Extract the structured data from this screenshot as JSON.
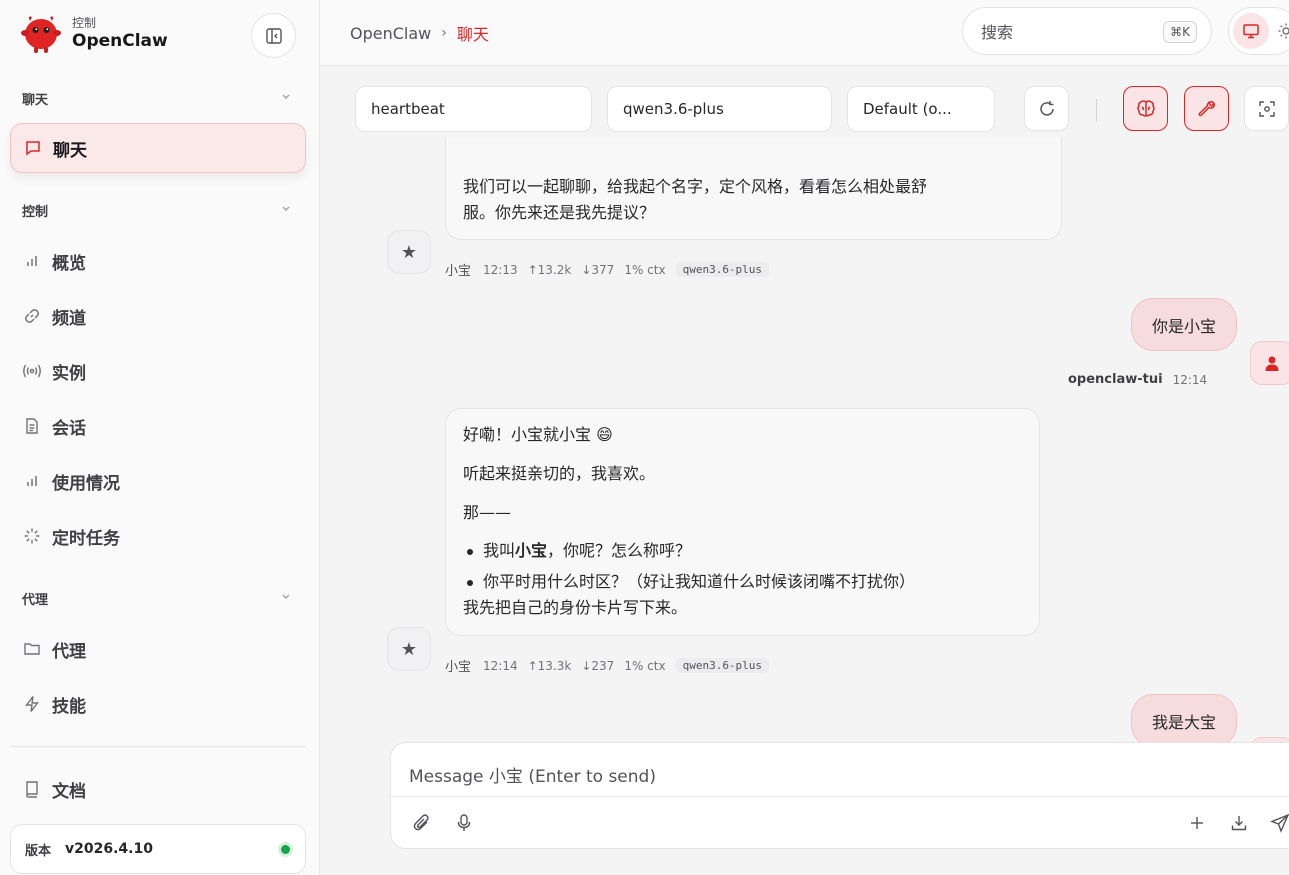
{
  "brand": {
    "subtitle": "控制",
    "name": "OpenClaw"
  },
  "sidebar": {
    "sections": [
      {
        "label": "聊天"
      },
      {
        "label": "控制"
      },
      {
        "label": "代理"
      }
    ],
    "items": [
      {
        "label": "聊天",
        "icon": "message-icon",
        "active": true
      },
      {
        "label": "概览",
        "icon": "bar-chart-icon"
      },
      {
        "label": "频道",
        "icon": "link-icon"
      },
      {
        "label": "实例",
        "icon": "broadcast-icon"
      },
      {
        "label": "会话",
        "icon": "document-icon"
      },
      {
        "label": "使用情况",
        "icon": "bar-chart-icon"
      },
      {
        "label": "定时任务",
        "icon": "loader-icon"
      },
      {
        "label": "代理",
        "icon": "folder-icon"
      },
      {
        "label": "技能",
        "icon": "bolt-icon"
      },
      {
        "label": "文档",
        "icon": "book-icon"
      }
    ],
    "version_label": "版本",
    "version_value": "v2026.4.10"
  },
  "topbar": {
    "breadcrumb_root": "OpenClaw",
    "breadcrumb_sep": "›",
    "breadcrumb_current": "聊天",
    "search_placeholder": "搜索",
    "search_shortcut": "⌘K"
  },
  "toolbar": {
    "session": "heartbeat",
    "model": "qwen3.6-plus",
    "thinking": "Default (o..."
  },
  "messages": [
    {
      "role": "assistant",
      "lines": [
        "我们可以一起聊聊，给我起个名字，定个风格，看看怎么相处最舒",
        "服。你先来还是我先提议？"
      ],
      "author": "小宝",
      "time": "12:13",
      "tokens_up": "↑13.2k",
      "tokens_down": "↓377",
      "ctx": "1% ctx",
      "model": "qwen3.6-plus"
    },
    {
      "role": "user",
      "text": "你是小宝",
      "author": "openclaw-tui",
      "time": "12:14"
    },
    {
      "role": "assistant",
      "p1": "好嘞！小宝就小宝 😄",
      "p2": "听起来挺亲切的，我喜欢。",
      "p3": "那——",
      "li1_pre": "我叫",
      "li1_bold": "小宝",
      "li1_post": "，你呢？怎么称呼？",
      "li2": "你平时用什么时区？（好让我知道什么时候该闭嘴不打扰你）",
      "tail": "我先把自己的身份卡片写下来。",
      "author": "小宝",
      "time": "12:14",
      "tokens_up": "↑13.3k",
      "tokens_down": "↓237",
      "ctx": "1% ctx",
      "model": "qwen3.6-plus"
    },
    {
      "role": "user",
      "text": "我是大宝"
    }
  ],
  "composer": {
    "placeholder": "Message 小宝 (Enter to send)"
  },
  "colors": {
    "accent": "#dc2626",
    "active_bg": "#fbe9ea",
    "status_online": "#16a34a"
  }
}
